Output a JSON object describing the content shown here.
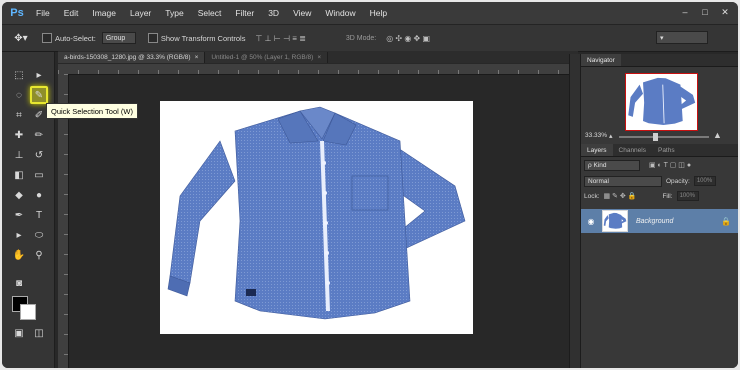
{
  "app": {
    "logo": "Ps"
  },
  "menu": [
    "File",
    "Edit",
    "Image",
    "Layer",
    "Type",
    "Select",
    "Filter",
    "3D",
    "View",
    "Window",
    "Help"
  ],
  "window_controls": {
    "minimize": "–",
    "restore": "□",
    "close": "✕"
  },
  "options_bar": {
    "auto_select_label": "Auto-Select:",
    "auto_select_value": "Group",
    "transform_label": "Show Transform Controls",
    "mode_3d_label": "3D Mode:",
    "align_icons": "⊤ ⊥ ⊢ ⊣ ≡ ≣"
  },
  "doc_tabs": [
    {
      "label": "a-birds-150308_1280.jpg @ 33.3% (RGB/8)",
      "close": "×"
    },
    {
      "label": "Untitled-1 @ 50% (Layer 1, RGB/8)",
      "close": "×"
    }
  ],
  "tooltip": {
    "text": "Quick Selection Tool (W)"
  },
  "navigator": {
    "tabs": [
      "Navigator"
    ],
    "zoom": "33.33%",
    "zoom_slider_fraction": 0.4
  },
  "layers": {
    "tabs": [
      "Layers",
      "Channels",
      "Paths"
    ],
    "kind_label": "ρ Kind",
    "blend_mode": "Normal",
    "opacity_label": "Opacity:",
    "opacity_value": "100%",
    "lock_label": "Lock:",
    "fill_label": "Fill:",
    "fill_value": "100%",
    "layer_name": "Background"
  },
  "colors": {
    "accent": "#5fb6ff",
    "highlight": "#e8e830",
    "layer_selected": "#5d7fa8",
    "shirt": "#5b7cc4"
  }
}
